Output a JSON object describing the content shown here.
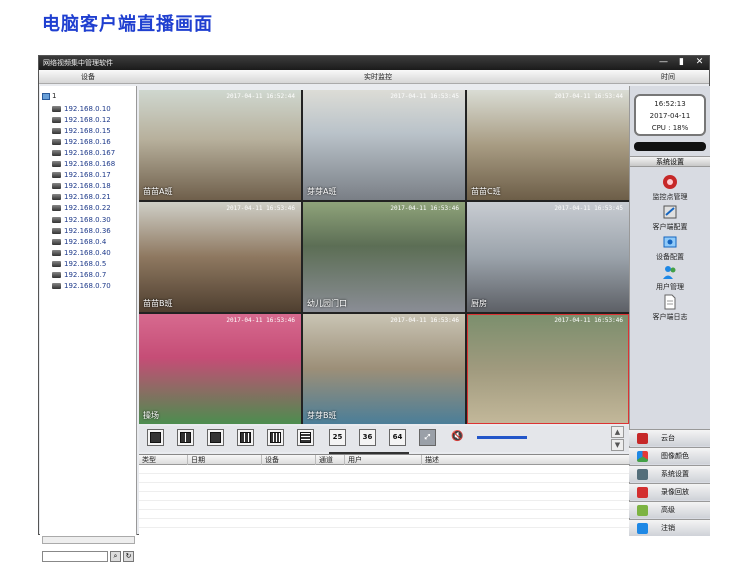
{
  "heading": "电脑客户端直播画面",
  "window": {
    "title": "网络视频集中管理软件",
    "min": "—",
    "max": "▮",
    "close": "✕"
  },
  "header": {
    "devices": "设备",
    "live": "实时监控",
    "time": "时间"
  },
  "tree": {
    "root": "1",
    "items": [
      "192.168.0.10",
      "192.168.0.12",
      "192.168.0.15",
      "192.168.0.16",
      "192.168.0.167",
      "192.168.0.168",
      "192.168.0.17",
      "192.168.0.18",
      "192.168.0.21",
      "192.168.0.22",
      "192.168.0.30",
      "192.168.0.36",
      "192.168.0.4",
      "192.168.0.40",
      "192.168.0.5",
      "192.168.0.7",
      "192.168.0.70"
    ]
  },
  "cameras": [
    {
      "label": "苗苗A班",
      "timestamp": "2017-04-11 16:52:44"
    },
    {
      "label": "芽芽A班",
      "timestamp": "2017-04-11 16:53:45"
    },
    {
      "label": "苗苗C班",
      "timestamp": "2017-04-11 16:53:44"
    },
    {
      "label": "苗苗B班",
      "timestamp": "2017-04-11 16:53:46"
    },
    {
      "label": "幼儿园门口",
      "timestamp": "2017-04-11 16:53:46"
    },
    {
      "label": "厨房",
      "timestamp": "2017-04-11 16:53:45"
    },
    {
      "label": "操场",
      "timestamp": "2017-04-11 16:53:46"
    },
    {
      "label": "芽芽B班",
      "timestamp": "2017-04-11 16:53:46"
    },
    {
      "label": "",
      "timestamp": "2017-04-11 16:53:46"
    }
  ],
  "clock": {
    "time": "16:52:13",
    "date": "2017-04-11",
    "cpu": "CPU : 18%"
  },
  "settings": {
    "title": "系统设置",
    "items": [
      "监控点管理",
      "客户端配置",
      "设备配置",
      "用户管理",
      "客户端日志"
    ]
  },
  "nav": [
    "云台",
    "图像颜色",
    "系统设置",
    "录像回放",
    "高级",
    "注销"
  ],
  "toolbar": {
    "layouts": [
      "25",
      "36",
      "64"
    ]
  },
  "table": {
    "columns": [
      "类型",
      "日期",
      "设备",
      "通道",
      "用户",
      "描述"
    ]
  },
  "colors": {
    "heading": "#1f3fd0",
    "accent": "#2356c9"
  }
}
